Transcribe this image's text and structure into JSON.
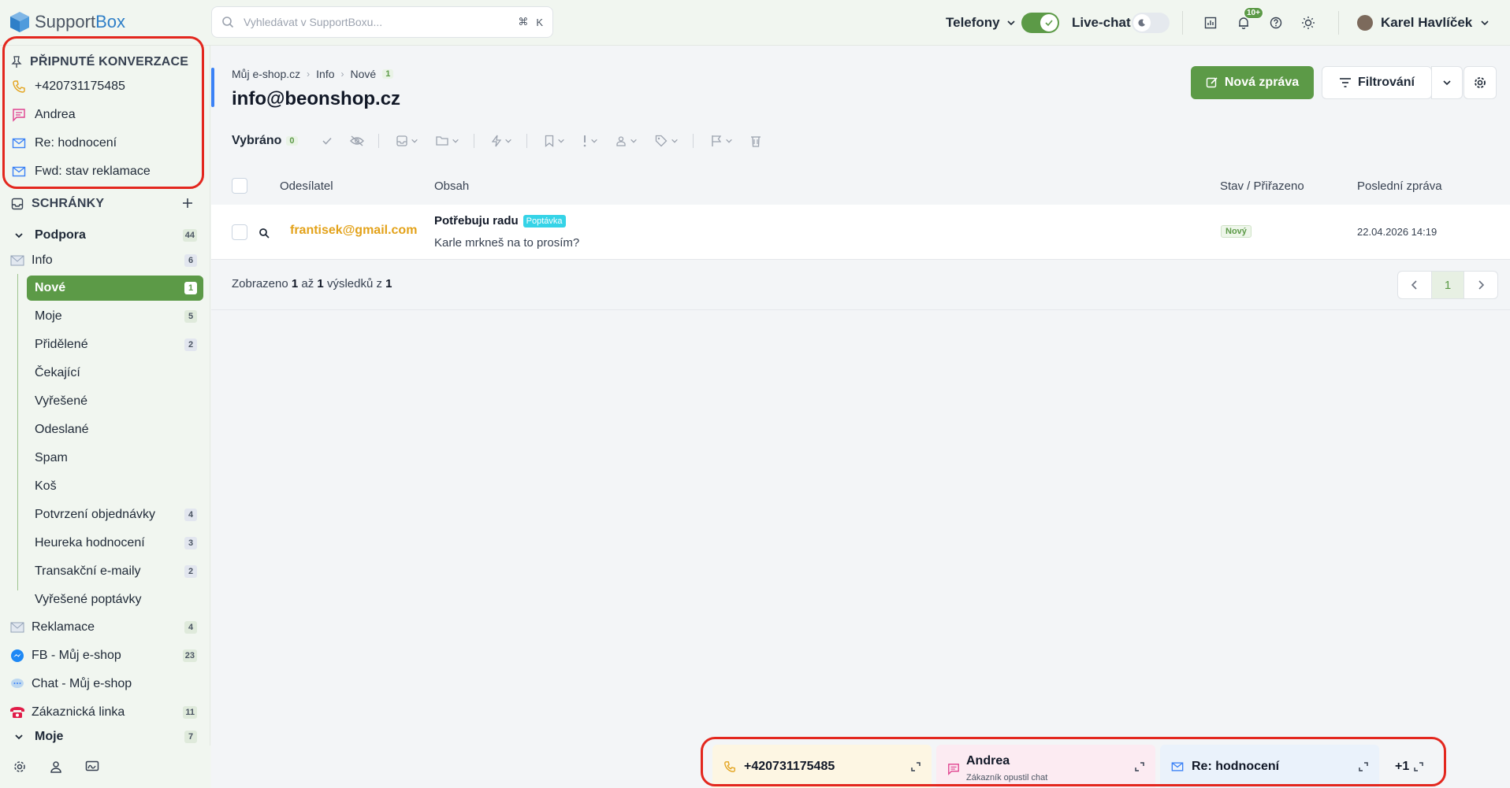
{
  "app": {
    "logo_support": "Support",
    "logo_box": "Box"
  },
  "search": {
    "placeholder": "Vyhledávat v SupportBoxu...",
    "shortcut_cmd": "⌘",
    "shortcut_key": "K"
  },
  "topbar": {
    "phones_label": "Telefony",
    "livechat_label": "Live-chat",
    "notifications_count": "10+",
    "user_name": "Karel Havlíček"
  },
  "sidebar": {
    "pinned_header": "PŘIPNUTÉ KONVERZACE",
    "pinned": [
      {
        "label": "+420731175485",
        "icon": "phone-icon"
      },
      {
        "label": "Andrea",
        "icon": "chat-icon"
      },
      {
        "label": "Re: hodnocení",
        "icon": "mail-icon"
      },
      {
        "label": "Fwd: stav reklamace",
        "icon": "mail-icon"
      }
    ],
    "boxes_header": "SCHRÁNKY",
    "group_podpora": {
      "label": "Podpora",
      "count": "44"
    },
    "info": {
      "label": "Info",
      "count": "6"
    },
    "info_items": [
      {
        "label": "Nové",
        "count": "1"
      },
      {
        "label": "Moje",
        "count": "5"
      },
      {
        "label": "Přidělené",
        "count": "2"
      },
      {
        "label": "Čekající",
        "count": ""
      },
      {
        "label": "Vyřešené",
        "count": ""
      },
      {
        "label": "Odeslané",
        "count": ""
      },
      {
        "label": "Spam",
        "count": ""
      },
      {
        "label": "Koš",
        "count": ""
      },
      {
        "label": "Potvrzení objednávky",
        "count": "4"
      },
      {
        "label": "Heureka hodnocení",
        "count": "3"
      },
      {
        "label": "Transakční e-maily",
        "count": "2"
      },
      {
        "label": "Vyřešené poptávky",
        "count": ""
      }
    ],
    "other_boxes": [
      {
        "label": "Reklamace",
        "count": "4"
      },
      {
        "label": "FB - Můj e-shop",
        "count": "23"
      },
      {
        "label": "Chat - Můj e-shop",
        "count": ""
      },
      {
        "label": "Zákaznická linka",
        "count": "11"
      }
    ],
    "group_moje": {
      "label": "Moje",
      "count": "7"
    }
  },
  "main": {
    "breadcrumb": [
      "Můj e-shop.cz",
      "Info",
      "Nové"
    ],
    "breadcrumb_count": "1",
    "title": "info@beonshop.cz",
    "new_message": "Nová zpráva",
    "filter": "Filtrování",
    "selected_label": "Vybráno",
    "selected_count": "0",
    "columns": {
      "sender": "Odesílatel",
      "content": "Obsah",
      "status": "Stav / Přiřazeno",
      "last": "Poslední zpráva"
    },
    "rows": [
      {
        "sender": "frantisek@gmail.com",
        "subject": "Potřebuju radu",
        "tag": "Poptávka",
        "preview": "Karle mrkneš na to prosím?",
        "status": "Nový",
        "date": "22.04.2026 14:19"
      }
    ],
    "results": {
      "prefix": "Zobrazeno",
      "from": "1",
      "to_word": "až",
      "to": "1",
      "results_word": "výsledků z",
      "total": "1"
    },
    "page": "1"
  },
  "dock": [
    {
      "label": "+420731175485",
      "sub": ""
    },
    {
      "label": "Andrea",
      "sub": "Zákazník opustil chat"
    },
    {
      "label": "Re: hodnocení",
      "sub": ""
    },
    {
      "label": "+1",
      "sub": ""
    }
  ],
  "colors": {
    "brand_green": "#5c9a47",
    "highlight_red": "#e3271e",
    "sender_orange": "#e3a21a"
  }
}
